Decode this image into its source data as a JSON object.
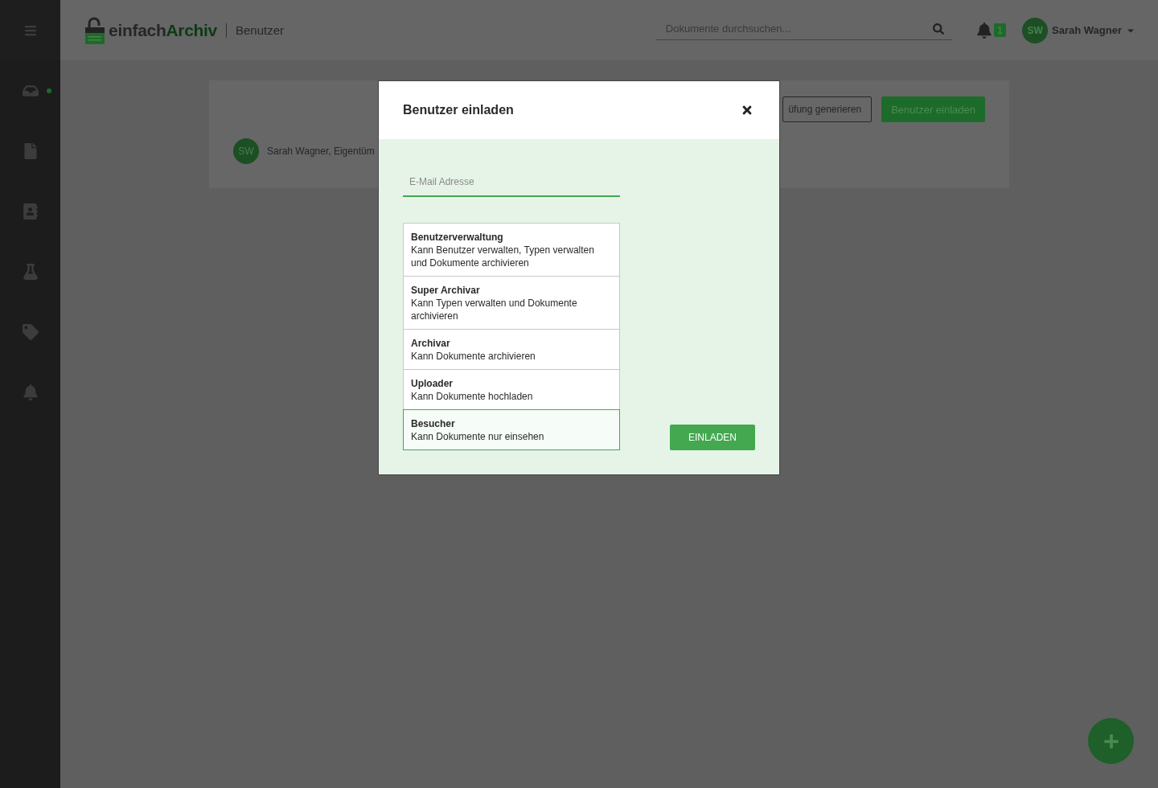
{
  "header": {
    "logo": {
      "part_1": "einfach",
      "part_2": "Archiv"
    },
    "page_title": "Benutzer",
    "search": {
      "placeholder": "Dokumente durchsuchen..."
    },
    "notification_count": "1",
    "user": {
      "initials": "SW",
      "name": "Sarah Wagner"
    }
  },
  "sidebar": {
    "items": [
      {
        "selected": true
      },
      {
        "selected": false
      },
      {
        "selected": false
      },
      {
        "selected": false
      },
      {
        "selected": false
      },
      {
        "selected": false
      }
    ]
  },
  "card": {
    "buttons": [
      "üfung generieren",
      "Benutzer einladen"
    ],
    "member": {
      "initials": "SW",
      "text": "Sarah Wagner, Eigentüm"
    }
  },
  "dialog": {
    "title": "Benutzer einladen",
    "email": {
      "placeholder": "E-Mail Adresse"
    },
    "roles": [
      {
        "name": "Benutzerverwaltung",
        "description": "Kann Benutzer verwalten, Typen verwalten und Dokumente archivieren",
        "selected": false
      },
      {
        "name": "Super Archivar",
        "description": "Kann Typen verwalten und Dokumente archivieren",
        "selected": false
      },
      {
        "name": "Archivar",
        "description": "Kann Dokumente archivieren",
        "selected": false
      },
      {
        "name": "Uploader",
        "description": "Kann Dokumente hochladen",
        "selected": false
      },
      {
        "name": "Besucher",
        "description": "Kann Dokumente nur einsehen",
        "selected": true
      }
    ],
    "submit": "EINLADEN"
  }
}
